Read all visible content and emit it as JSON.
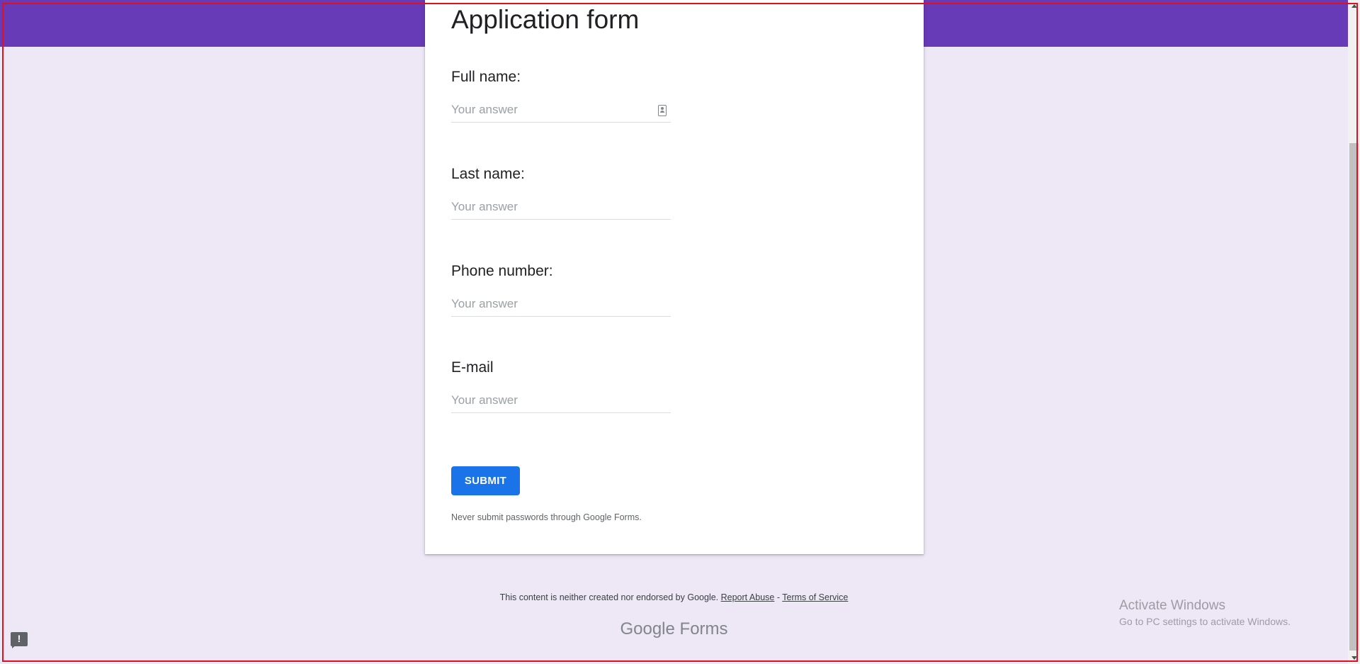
{
  "form": {
    "title": "Application form",
    "questions": [
      {
        "label": "Full name:",
        "placeholder": "Your answer",
        "value": ""
      },
      {
        "label": "Last name:",
        "placeholder": "Your answer",
        "value": ""
      },
      {
        "label": "Phone number:",
        "placeholder": "Your answer",
        "value": ""
      },
      {
        "label": "E-mail",
        "placeholder": "Your answer",
        "value": ""
      }
    ],
    "submit_label": "SUBMIT",
    "password_warning": "Never submit passwords through Google Forms."
  },
  "footer": {
    "disclaimer": "This content is neither created nor endorsed by Google.",
    "report_abuse": "Report Abuse",
    "separator": "-",
    "terms": "Terms of Service",
    "logo_brand": "Google",
    "logo_product": "Forms"
  },
  "feedback": {
    "symbol": "!"
  },
  "watermark": {
    "title": "Activate Windows",
    "subtitle": "Go to PC settings to activate Windows."
  },
  "icons": {
    "autofill": "contact-card-icon",
    "feedback": "feedback-icon"
  },
  "colors": {
    "header": "#673ab7",
    "background": "#ede7f6",
    "submit": "#1a73e8"
  }
}
